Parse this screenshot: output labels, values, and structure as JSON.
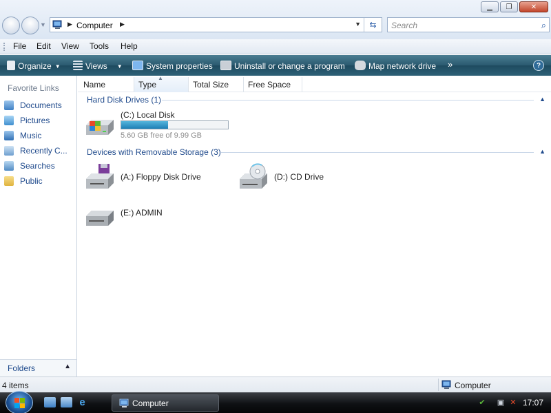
{
  "window": {
    "controls": {
      "minimize": "▁",
      "maximize": "❐",
      "close": "✕"
    }
  },
  "address_bar": {
    "breadcrumb": "Computer",
    "sep1": "▶",
    "sep2": "▶",
    "dropdown": "▼",
    "refresh": "⇆"
  },
  "search": {
    "placeholder": "Search",
    "icon": "search-icon"
  },
  "menu": [
    "File",
    "Edit",
    "View",
    "Tools",
    "Help"
  ],
  "command_bar": {
    "organize": "Organize",
    "views": "Views",
    "system_properties": "System properties",
    "uninstall": "Uninstall or change a program",
    "map_drive": "Map network drive",
    "more": "»",
    "help": "?"
  },
  "left_pane": {
    "heading": "Favorite Links",
    "links": [
      "Documents",
      "Pictures",
      "Music",
      "Recently C...",
      "Searches",
      "Public"
    ],
    "folders_label": "Folders",
    "folders_chevron": "▲"
  },
  "columns": {
    "name": "Name",
    "type": "Type",
    "total_size": "Total Size",
    "free_space": "Free Space",
    "sort_arrow": "▲"
  },
  "groups": {
    "hard_disks": "Hard Disk Drives (1)",
    "removable": "Devices with Removable Storage (3)",
    "chevron": "▲"
  },
  "drives": {
    "local": {
      "name": "(C:) Local Disk",
      "free_text": "5.60 GB free of 9.99 GB",
      "used_fraction": 0.44
    },
    "floppy": {
      "name": "(A:) Floppy Disk Drive"
    },
    "cd": {
      "name": "(D:) CD Drive"
    },
    "admin": {
      "name": "(E:) ADMIN"
    }
  },
  "status_bar": {
    "items": "4 items",
    "zone": "Computer"
  },
  "taskbar": {
    "window_label": "Computer",
    "clock": "17:07"
  },
  "colors": {
    "command_bar": "#2a5a70",
    "link_blue": "#1f4a8c",
    "progress_fill": "#1d7fb5"
  }
}
